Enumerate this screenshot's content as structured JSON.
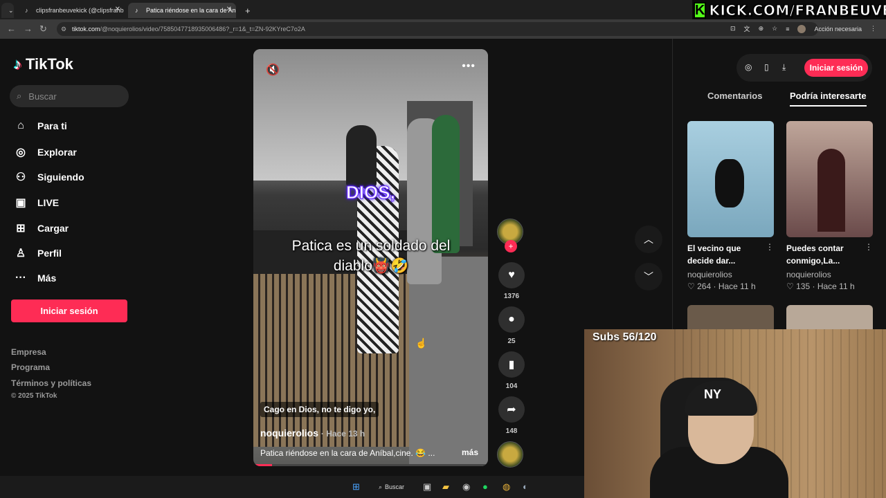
{
  "browser": {
    "tabs": [
      {
        "title": "clipsfranbeuvekick (@clipsfranb"
      },
      {
        "title": "Patica riéndose en la cara de An"
      }
    ],
    "new_tab_icon": "+",
    "url_domain": "tiktok.com",
    "url_path": "/@noquierolios/video/7585047718935006486?_r=1&_t=ZN-92KYreC7o2A",
    "action_needed": "Acción necesaria"
  },
  "overlay": {
    "kick_logo": "K",
    "kick_text": "KICK.COM/FRANBEUVE"
  },
  "tiktok": {
    "brand": "TikTok",
    "search_placeholder": "Buscar",
    "nav": [
      {
        "label": "Para ti",
        "icon": "home-icon"
      },
      {
        "label": "Explorar",
        "icon": "compass-icon"
      },
      {
        "label": "Siguiendo",
        "icon": "following-icon"
      },
      {
        "label": "LIVE",
        "icon": "live-icon"
      },
      {
        "label": "Cargar",
        "icon": "upload-icon"
      },
      {
        "label": "Perfil",
        "icon": "profile-icon"
      },
      {
        "label": "Más",
        "icon": "more-icon"
      }
    ],
    "login_label": "Iniciar sesión",
    "footer": [
      "Empresa",
      "Programa",
      "Términos y políticas"
    ],
    "copyright": "© 2025 TikTok"
  },
  "video": {
    "caption_top": "DIOS,",
    "caption_main": "Patica es un soldado del diablo👹🤣",
    "subtitle": "Cago en Dios, no te digo yo,",
    "author": "noquierolios",
    "time": "· Hace 13 h",
    "description": "Patica riéndose en la cara de Aníbal,cine. 😂 ...",
    "more_label": "más",
    "progress": 0.08,
    "likes": "1376",
    "comments": "25",
    "saves": "104",
    "shares": "148"
  },
  "right_panel": {
    "login_label": "Iniciar sesión",
    "tabs": [
      "Comentarios",
      "Podría interesarte"
    ],
    "recommendations": [
      {
        "title": "El vecino que decide dar...",
        "author": "noquierolios",
        "views": "264",
        "time": "· Hace 11 h"
      },
      {
        "title": "Puedes contar conmigo,La...",
        "author": "noquierolios",
        "views": "135",
        "time": "· Hace 11 h"
      }
    ]
  },
  "webcam": {
    "subs_text": "Subs 56/120",
    "cap_logo": "NY"
  },
  "taskbar": {
    "search_label": "Buscar"
  }
}
